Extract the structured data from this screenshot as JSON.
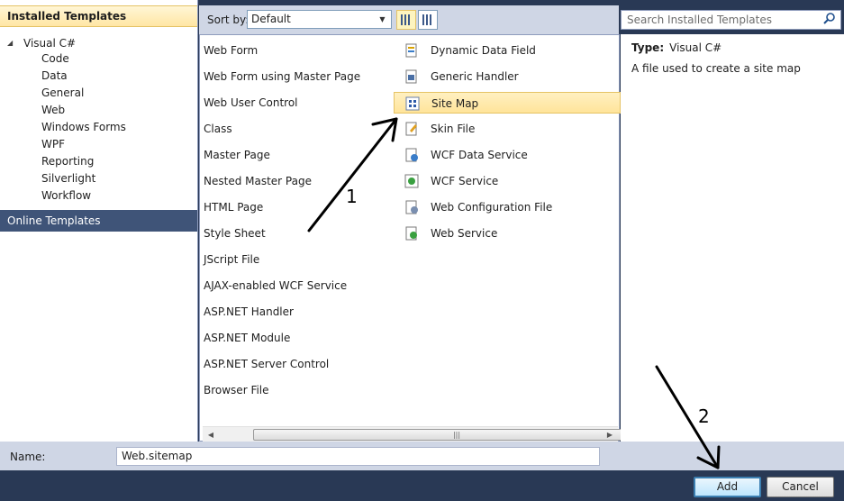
{
  "left_pane": {
    "installed_header": "Installed Templates",
    "tree_root": "Visual C#",
    "tree_items": [
      "Code",
      "Data",
      "General",
      "Web",
      "Windows Forms",
      "WPF",
      "Reporting",
      "Silverlight",
      "Workflow"
    ],
    "online_header": "Online Templates"
  },
  "toolbar": {
    "sort_label": "Sort by:",
    "sort_value": "Default"
  },
  "search": {
    "placeholder": "Search Installed Templates"
  },
  "templates_col1": [
    "Web Form",
    "Web Form using Master Page",
    "Web User Control",
    "Class",
    "Master Page",
    "Nested Master Page",
    "HTML Page",
    "Style Sheet",
    "JScript File",
    "AJAX-enabled WCF Service",
    "ASP.NET Handler",
    "ASP.NET Module",
    "ASP.NET Server Control",
    "Browser File"
  ],
  "templates_col2": [
    {
      "label": "Dynamic Data Field",
      "icon": "dynamic-data-icon"
    },
    {
      "label": "Generic Handler",
      "icon": "handler-icon"
    },
    {
      "label": "Site Map",
      "icon": "sitemap-icon"
    },
    {
      "label": "Skin File",
      "icon": "skin-file-icon"
    },
    {
      "label": "WCF Data Service",
      "icon": "wcf-data-icon"
    },
    {
      "label": "WCF Service",
      "icon": "wcf-service-icon"
    },
    {
      "label": "Web Configuration File",
      "icon": "config-file-icon"
    },
    {
      "label": "Web Service",
      "icon": "web-service-icon"
    }
  ],
  "selected_template": "Site Map",
  "details": {
    "type_label": "Type:",
    "type_value": "Visual C#",
    "description": "A file used to create a site map"
  },
  "name_bar": {
    "label": "Name:",
    "value": "Web.sitemap"
  },
  "buttons": {
    "add": "Add",
    "cancel": "Cancel"
  },
  "annotations": [
    "1",
    "2"
  ],
  "colors": {
    "background": "#293955",
    "selection": "#ffe49a",
    "online_header": "#3f5478"
  }
}
